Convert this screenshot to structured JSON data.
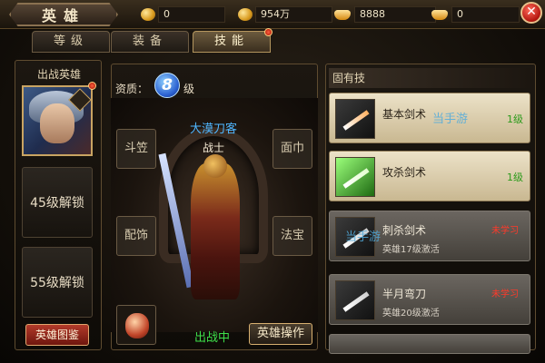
{
  "window": {
    "title": "英雄"
  },
  "resources": [
    {
      "icon": "gold-coin-icon",
      "value": "0"
    },
    {
      "icon": "coin-stack-icon",
      "value": "954万"
    },
    {
      "icon": "gold-ingot-icon",
      "value": "8888"
    },
    {
      "icon": "silver-ingot-icon",
      "value": "0"
    }
  ],
  "tabs": [
    {
      "label": "等级",
      "active": false
    },
    {
      "label": "装备",
      "active": false
    },
    {
      "label": "技能",
      "active": true
    }
  ],
  "left": {
    "title": "出战英雄",
    "slots": [
      "45级解锁",
      "55级解锁"
    ],
    "codex_button": "英雄图鉴"
  },
  "hero": {
    "aptitude_label": "资质：",
    "grade": "8",
    "grade_suffix": "级",
    "name": "大漠刀客",
    "class": "战士",
    "equip_slots": [
      "斗笠",
      "面巾",
      "配饰",
      "法宝"
    ],
    "status": "出战中",
    "operate_button": "英雄操作"
  },
  "skills": {
    "title": "固有技",
    "items": [
      {
        "name": "基本剑术",
        "level": "1级",
        "locked": false
      },
      {
        "name": "攻杀剑术",
        "level": "1级",
        "locked": false
      },
      {
        "name": "刺杀剑术",
        "state": "未学习",
        "note": "英雄17级激活",
        "locked": true
      },
      {
        "name": "半月弯刀",
        "state": "未学习",
        "note": "英雄20级激活",
        "locked": true
      }
    ]
  },
  "watermarks": [
    "当手游",
    "当手游"
  ],
  "colors": {
    "accent": "#c9a462",
    "active_green": "#3ee04a",
    "locked_red": "#ff3a2a",
    "name_blue": "#4fb6ff"
  }
}
